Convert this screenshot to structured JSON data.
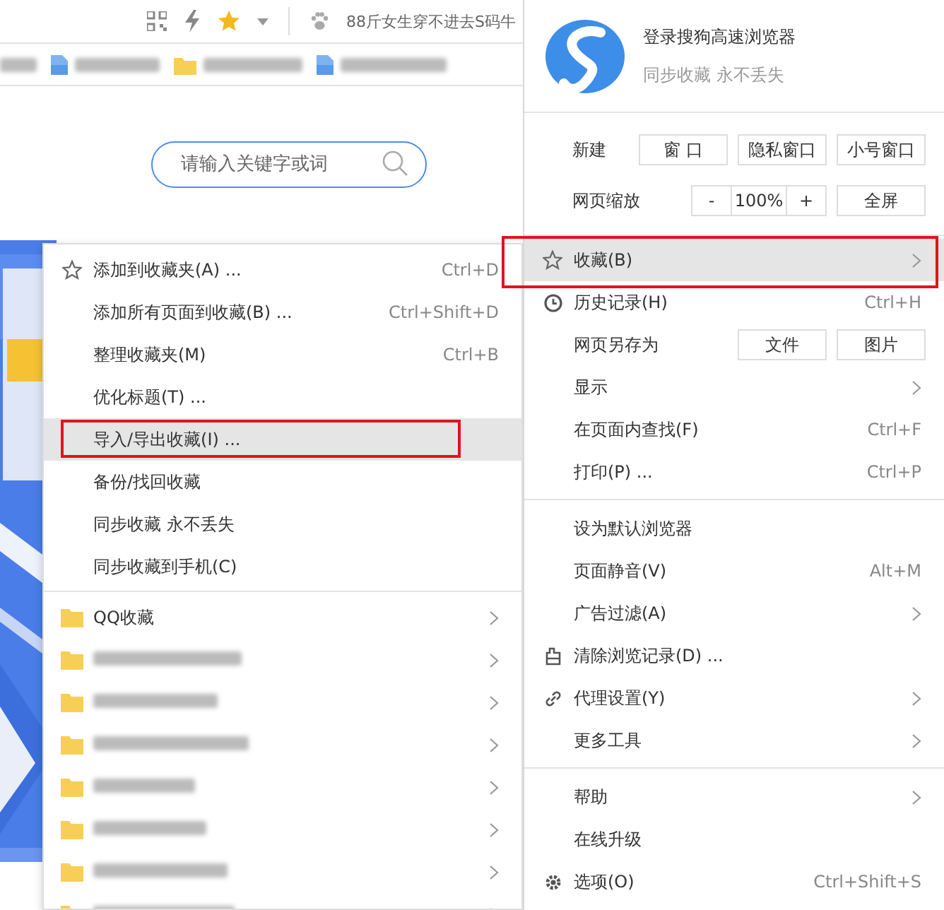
{
  "toolbar": {
    "tab_title": "88斤女生穿不进去S码牛"
  },
  "bookmarks_bar": [
    {
      "kind": "text"
    },
    {
      "kind": "page"
    },
    {
      "kind": "folder"
    },
    {
      "kind": "page"
    }
  ],
  "search": {
    "placeholder": "请输入关键字或词"
  },
  "favorites_menu": {
    "items": [
      {
        "kind": "bookmark",
        "label": "添加到收藏夹(A) ...",
        "shortcut": "Ctrl+D",
        "selected": false,
        "annotated": false
      },
      {
        "kind": "plain",
        "label": "添加所有页面到收藏(B) ...",
        "shortcut": "Ctrl+Shift+D",
        "selected": false,
        "annotated": false
      },
      {
        "kind": "plain",
        "label": "整理收藏夹(M)",
        "shortcut": "Ctrl+B",
        "selected": false,
        "annotated": false
      },
      {
        "kind": "plain",
        "label": "优化标题(T) ...",
        "selected": false,
        "annotated": false
      },
      {
        "kind": "plain",
        "label": "导入/导出收藏(I) ...",
        "selected": true,
        "annotated": true
      },
      {
        "kind": "plain",
        "label": "备份/找回收藏",
        "selected": false,
        "annotated": false
      },
      {
        "kind": "plain",
        "label": "同步收藏 永不丢失",
        "selected": false,
        "annotated": false
      },
      {
        "kind": "plain",
        "label": "同步收藏到手机(C)",
        "selected": false,
        "annotated": false
      }
    ],
    "folders": [
      {
        "kind": "named",
        "label": "QQ收藏",
        "has_submenu": true
      },
      {
        "kind": "blurred",
        "has_submenu": true
      },
      {
        "kind": "blurred",
        "has_submenu": true
      },
      {
        "kind": "blurred",
        "has_submenu": true
      },
      {
        "kind": "blurred",
        "has_submenu": true
      },
      {
        "kind": "blurred",
        "has_submenu": true
      },
      {
        "kind": "blurred",
        "has_submenu": true
      },
      {
        "kind": "blurred",
        "has_submenu": true
      }
    ]
  },
  "main_menu": {
    "account": {
      "title": "登录搜狗高速浏览器",
      "subtitle": "同步收藏 永不丢失"
    },
    "new_row": {
      "label": "新建",
      "buttons": [
        "窗 口",
        "隐私窗口",
        "小号窗口"
      ]
    },
    "zoom_row": {
      "label": "网页缩放",
      "minus": "-",
      "value": "100%",
      "plus": "+",
      "fullscreen": "全屏"
    },
    "groups": [
      [
        {
          "kind": "bookmark",
          "label": "收藏(B)",
          "has_submenu": true,
          "selected": true,
          "annotated": true
        },
        {
          "kind": "history",
          "label": "历史记录(H)",
          "shortcut": "Ctrl+H",
          "has_submenu": false,
          "selected": false,
          "annotated": false
        },
        {
          "kind": "save",
          "label": "网页另存为",
          "buttons": [
            "文件",
            "图片"
          ],
          "has_submenu": false,
          "selected": false,
          "annotated": false
        },
        {
          "kind": "plain",
          "label": "显示",
          "has_submenu": true,
          "selected": false,
          "annotated": false
        },
        {
          "kind": "plain",
          "label": "在页面内查找(F)",
          "shortcut": "Ctrl+F",
          "has_submenu": false,
          "selected": false,
          "annotated": false
        },
        {
          "kind": "plain",
          "label": "打印(P) ...",
          "shortcut": "Ctrl+P",
          "has_submenu": false,
          "selected": false,
          "annotated": false
        }
      ],
      [
        {
          "kind": "plain",
          "label": "设为默认浏览器",
          "has_submenu": false,
          "selected": false,
          "annotated": false
        },
        {
          "kind": "plain",
          "label": "页面静音(V)",
          "shortcut": "Alt+M",
          "has_submenu": false,
          "selected": false,
          "annotated": false
        },
        {
          "kind": "plain",
          "label": "广告过滤(A)",
          "has_submenu": true,
          "selected": false,
          "annotated": false
        },
        {
          "kind": "clear",
          "label": "清除浏览记录(D) ...",
          "has_submenu": false,
          "selected": false,
          "annotated": false
        },
        {
          "kind": "proxy",
          "label": "代理设置(Y)",
          "has_submenu": true,
          "selected": false,
          "annotated": false
        },
        {
          "kind": "plain",
          "label": "更多工具",
          "has_submenu": true,
          "selected": false,
          "annotated": false
        }
      ],
      [
        {
          "kind": "plain",
          "label": "帮助",
          "has_submenu": true,
          "selected": false,
          "annotated": false
        },
        {
          "kind": "plain",
          "label": "在线升级",
          "has_submenu": false,
          "selected": false,
          "annotated": false
        },
        {
          "kind": "options",
          "label": "选项(O)",
          "shortcut": "Ctrl+Shift+S",
          "has_submenu": false,
          "selected": false,
          "annotated": false
        }
      ]
    ]
  }
}
